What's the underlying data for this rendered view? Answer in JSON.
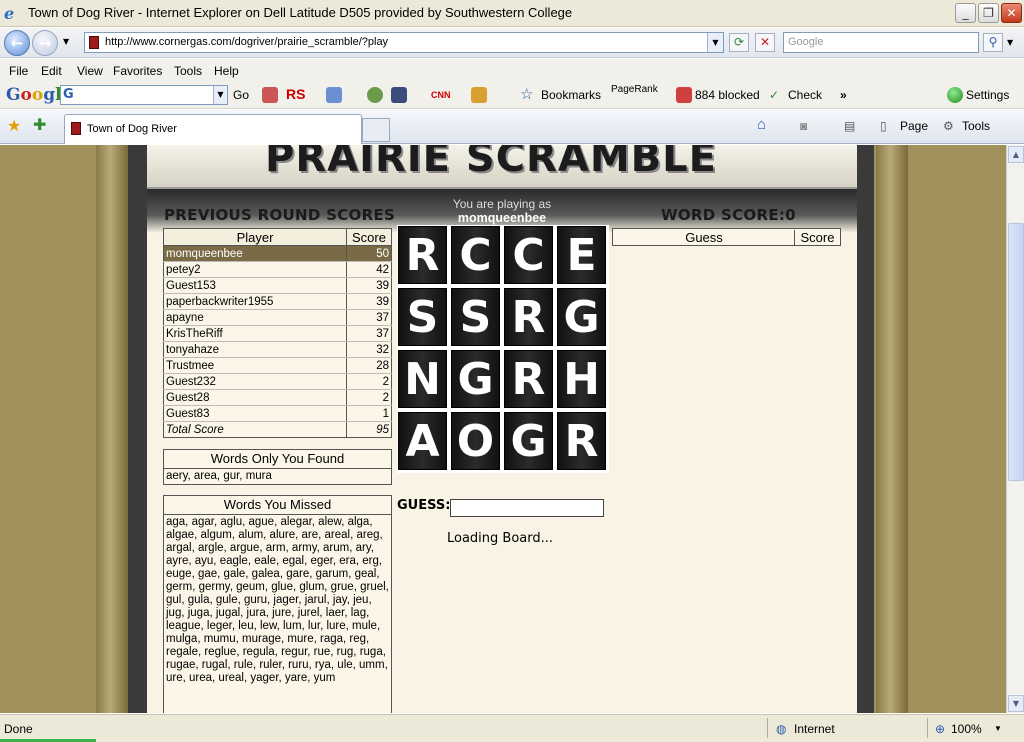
{
  "window": {
    "title": "Town of Dog River - Internet Explorer on Dell Latitude D505 provided by Southwestern College",
    "min": "_",
    "max": "❐",
    "close": "✕"
  },
  "address": {
    "url": "http://www.cornergas.com/dogriver/prairie_scramble/?play",
    "search_placeholder": "Google"
  },
  "menu": [
    "File",
    "Edit",
    "View",
    "Favorites",
    "Tools",
    "Help"
  ],
  "google_toolbar": {
    "logo": "Google",
    "go": "Go",
    "rs": "RS",
    "cnn": "CNN",
    "bookmarks": "Bookmarks",
    "pagerank": "PageRank",
    "blocked": "884 blocked",
    "check": "Check",
    "more": "»",
    "settings": "Settings"
  },
  "tabs": {
    "active": "Town of Dog River",
    "page": "Page",
    "tools": "Tools"
  },
  "game": {
    "banner": "PRAIRIE SCRAMBLE",
    "prev_scores_title": "PREVIOUS ROUND SCORES",
    "playing_as_label": "You are playing as",
    "player_name": "momqueenbee",
    "word_score_label": "WORD SCORE:0",
    "scores_headers": [
      "Player",
      "Score"
    ],
    "scores": [
      {
        "player": "momqueenbee",
        "score": "50"
      },
      {
        "player": "petey2",
        "score": "42"
      },
      {
        "player": "Guest153",
        "score": "39"
      },
      {
        "player": "paperbackwriter1955",
        "score": "39"
      },
      {
        "player": "apayne",
        "score": "37"
      },
      {
        "player": "KrisTheRiff",
        "score": "37"
      },
      {
        "player": "tonyahaze",
        "score": "32"
      },
      {
        "player": "Trustmee",
        "score": "28"
      },
      {
        "player": "Guest232",
        "score": "2"
      },
      {
        "player": "Guest28",
        "score": "2"
      },
      {
        "player": "Guest83",
        "score": "1"
      }
    ],
    "total_label": "Total Score",
    "total_score": "95",
    "only_you_title": "Words Only You Found",
    "only_you_words": "aery, area, gur, mura",
    "missed_title": "Words You Missed",
    "missed_words": "aga, agar, aglu, ague, alegar, alew, alga, algae, algum, alum, alure, are, areal, areg, argal, argle, argue, arm, army, arum, ary, ayre, ayu, eagle, eale, egal, eger, era, erg, euge, gae, gale, galea, gare, garum, geal, germ, germy, geum, glue, glum, grue, gruel, gul, gula, gule, guru, jager, jarul, jay, jeu, jug, juga, jugal, jura, jure, jurel, laer, lag, league, leger, leu, lew, lum, lur, lure, mule, mulga, mumu, murage, mure, raga, reg, regale, reglue, regula, regur, rue, rug, ruga, rugae, rugal, rule, ruler, ruru, rya, ule, umm, ure, urea, ureal, yager, yare, yum",
    "tiles": [
      "R",
      "C",
      "C",
      "E",
      "S",
      "S",
      "R",
      "G",
      "N",
      "G",
      "R",
      "H",
      "A",
      "O",
      "G",
      "R"
    ],
    "guess_label": "GUESS:",
    "guess_value": "",
    "loading": "Loading Board...",
    "ws_headers": [
      "Guess",
      "Score"
    ]
  },
  "status": {
    "left": "Done",
    "zone": "Internet",
    "zoom": "100%"
  }
}
